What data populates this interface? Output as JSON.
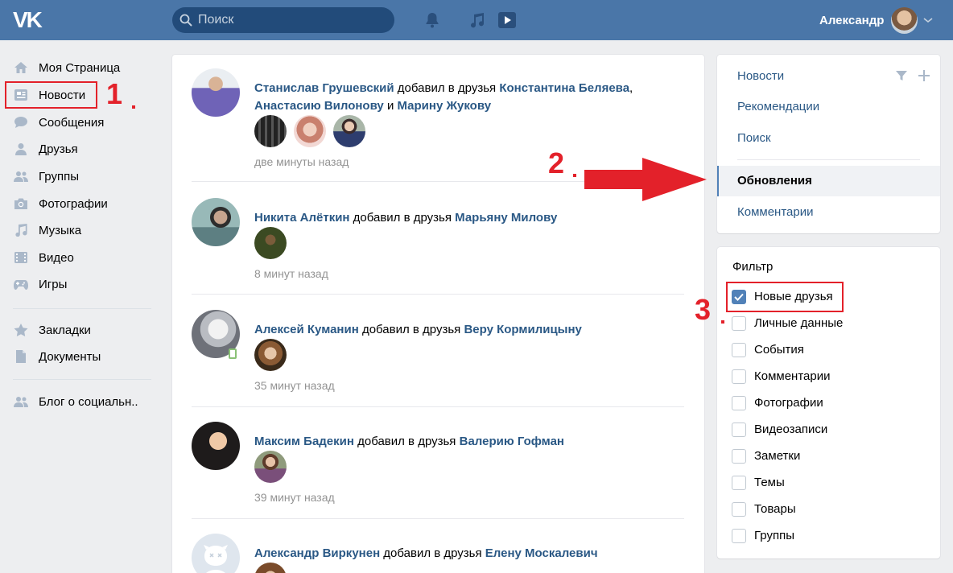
{
  "header": {
    "logo": "VK",
    "search_placeholder": "Поиск",
    "user_name": "Александр"
  },
  "sidebar": {
    "items": [
      {
        "label": "Моя Страница",
        "icon": "home-icon"
      },
      {
        "label": "Новости",
        "icon": "news-icon"
      },
      {
        "label": "Сообщения",
        "icon": "messages-icon"
      },
      {
        "label": "Друзья",
        "icon": "friends-icon"
      },
      {
        "label": "Группы",
        "icon": "groups-icon"
      },
      {
        "label": "Фотографии",
        "icon": "camera-icon"
      },
      {
        "label": "Музыка",
        "icon": "music-icon"
      },
      {
        "label": "Видео",
        "icon": "video-icon"
      },
      {
        "label": "Игры",
        "icon": "gamepad-icon"
      },
      {
        "label": "Закладки",
        "icon": "star-icon"
      },
      {
        "label": "Документы",
        "icon": "document-icon"
      },
      {
        "label": "Блог о социальн..",
        "icon": "people-icon"
      }
    ]
  },
  "annotations": {
    "one": "1",
    "two": "2",
    "three": "3"
  },
  "feed": {
    "posts": [
      {
        "author": "Станислав Грушевский",
        "action": " добавил в друзья ",
        "friend1": "Константина Беляева",
        "sep1": ",",
        "friend2": "Анастасию Вилонову",
        "and": " и ",
        "friend3": "Марину Жукову",
        "time": "две минуты назад"
      },
      {
        "author": "Никита Алёткин",
        "action": " добавил в друзья ",
        "friend1": "Марьяну Милову",
        "time": "8 минут назад"
      },
      {
        "author": "Алексей Куманин",
        "action": " добавил в друзья ",
        "friend1": "Веру Кормилицыну",
        "time": "35 минут назад"
      },
      {
        "author": "Максим Бадекин",
        "action": " добавил в друзья ",
        "friend1": "Валерию Гофман",
        "time": "39 минут назад"
      },
      {
        "author": "Александр Виркунен",
        "action": " добавил в друзья ",
        "friend1": "Елену Москалевич",
        "time": ""
      }
    ]
  },
  "right_nav": {
    "items": [
      "Новости",
      "Рекомендации",
      "Поиск",
      "Обновления",
      "Комментарии"
    ],
    "active": "Обновления"
  },
  "filter": {
    "title": "Фильтр",
    "options": [
      {
        "label": "Новые друзья",
        "checked": true
      },
      {
        "label": "Личные данные",
        "checked": false
      },
      {
        "label": "События",
        "checked": false
      },
      {
        "label": "Комментарии",
        "checked": false
      },
      {
        "label": "Фотографии",
        "checked": false
      },
      {
        "label": "Видеозаписи",
        "checked": false
      },
      {
        "label": "Заметки",
        "checked": false
      },
      {
        "label": "Темы",
        "checked": false
      },
      {
        "label": "Товары",
        "checked": false
      },
      {
        "label": "Группы",
        "checked": false
      }
    ]
  },
  "colors": {
    "header": "#4a76a8",
    "link": "#2a5885",
    "annotation": "#e3212a"
  }
}
